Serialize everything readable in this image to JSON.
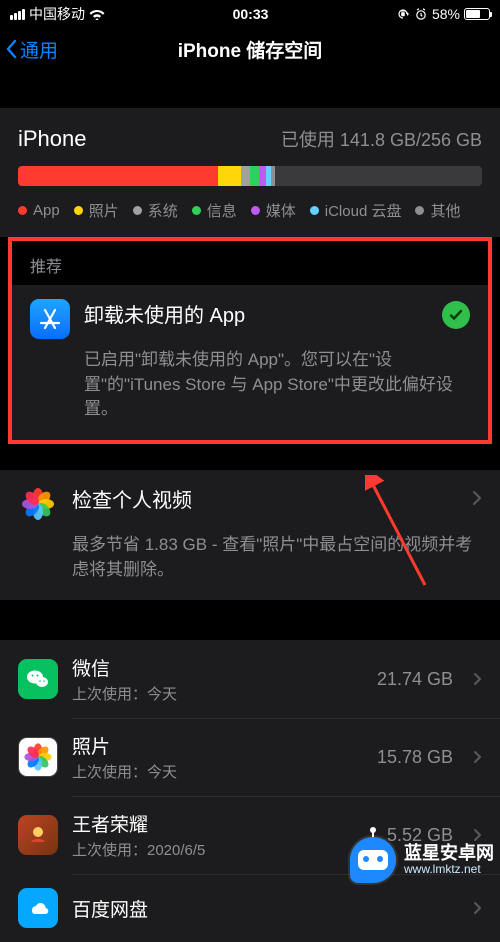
{
  "status": {
    "carrier": "中国移动",
    "time": "00:33",
    "battery_pct": "58%"
  },
  "nav": {
    "back": "通用",
    "title": "iPhone 储存空间"
  },
  "storage": {
    "device_label": "iPhone",
    "used_text": "已使用 141.8 GB/256 GB",
    "bar": [
      {
        "color": "#ff3b30",
        "pct": 43
      },
      {
        "color": "#ffd60a",
        "pct": 5
      },
      {
        "color": "#a0a0a5",
        "pct": 2
      },
      {
        "color": "#30d158",
        "pct": 2
      },
      {
        "color": "#bf5af2",
        "pct": 1.5
      },
      {
        "color": "#64d2ff",
        "pct": 1
      },
      {
        "color": "#8e8e93",
        "pct": 1
      }
    ],
    "legend": [
      {
        "color": "#ff3b30",
        "label": "App"
      },
      {
        "color": "#ffd60a",
        "label": "照片"
      },
      {
        "color": "#a0a0a5",
        "label": "系统"
      },
      {
        "color": "#30d158",
        "label": "信息"
      },
      {
        "color": "#bf5af2",
        "label": "媒体"
      },
      {
        "color": "#64d2ff",
        "label": "iCloud 云盘"
      },
      {
        "color": "#8e8e93",
        "label": "其他"
      }
    ]
  },
  "recommend": {
    "header": "推荐",
    "offload": {
      "title": "卸载未使用的 App",
      "desc": "已启用\"卸载未使用的 App\"。您可以在\"设置\"的\"iTunes Store 与 App Store\"中更改此偏好设置。"
    },
    "review_video": {
      "title": "检查个人视频",
      "desc": "最多节省 1.83 GB - 查看\"照片\"中最占空间的视频并考虑将其删除。"
    }
  },
  "apps": [
    {
      "name": "微信",
      "sub": "上次使用：今天",
      "size": "21.74 GB",
      "icon": "wechat"
    },
    {
      "name": "照片",
      "sub": "上次使用：今天",
      "size": "15.78 GB",
      "icon": "photos"
    },
    {
      "name": "王者荣耀",
      "sub": "上次使用：2020/6/5",
      "size": "5.52 GB",
      "icon": "wzry"
    },
    {
      "name": "百度网盘",
      "sub": "",
      "size": "",
      "icon": "baidupan"
    }
  ],
  "watermark": {
    "line1": "蓝星安卓网",
    "line2": "www.lmktz.net"
  }
}
